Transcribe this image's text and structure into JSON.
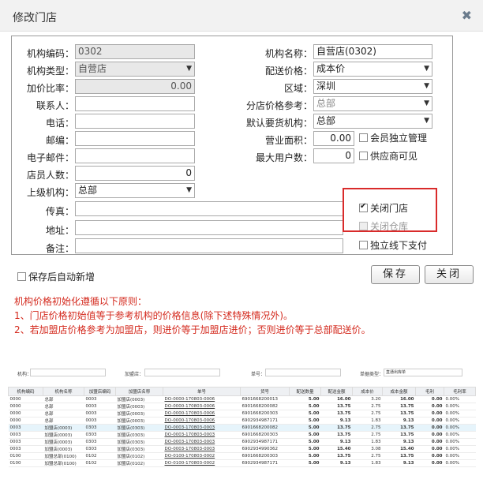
{
  "dialog": {
    "title": "修改门店",
    "close_icon": "✖"
  },
  "form": {
    "org_code": {
      "label": "机构编码：",
      "value": "0302"
    },
    "org_name": {
      "label": "机构名称：",
      "value": "自营店(0302)"
    },
    "org_type": {
      "label": "机构类型：",
      "value": "自营店"
    },
    "dist_price": {
      "label": "配送价格：",
      "value": "成本价"
    },
    "markup": {
      "label": "加价比率：",
      "value": "0.00"
    },
    "region": {
      "label": "区域：",
      "value": "深圳"
    },
    "contact": {
      "label": "联系人：",
      "value": ""
    },
    "branch_price_ref": {
      "label": "分店价格参考：",
      "value": "总部"
    },
    "phone": {
      "label": "电话：",
      "value": ""
    },
    "default_org": {
      "label": "默认要货机构：",
      "value": "总部"
    },
    "zip": {
      "label": "邮编：",
      "value": ""
    },
    "area": {
      "label": "营业面积：",
      "value": "0.00"
    },
    "email": {
      "label": "电子邮件：",
      "value": ""
    },
    "max_users": {
      "label": "最大用户数：",
      "value": "0"
    },
    "staff": {
      "label": "店员人数：",
      "value": "0"
    },
    "parent_org": {
      "label": "上级机构：",
      "value": "总部"
    },
    "fax": {
      "label": "传真：",
      "value": ""
    },
    "address": {
      "label": "地址：",
      "value": ""
    },
    "remark": {
      "label": "备注：",
      "value": ""
    },
    "chk_member": {
      "label": "会员独立管理",
      "checked": false
    },
    "chk_supplier": {
      "label": "供应商可见",
      "checked": false
    },
    "chk_close_store": {
      "label": "关闭门店",
      "checked": true
    },
    "chk_close_wh": {
      "label": "关闭仓库",
      "checked": false
    },
    "chk_offline_pay": {
      "label": "独立线下支付",
      "checked": false
    }
  },
  "footer": {
    "auto_new": "保存后自动新增",
    "save": "保存",
    "close": "关闭"
  },
  "notes": {
    "line1": "机构价格初始化遵循以下原则：",
    "line2": "1、门店价格初始值等于参考机构的价格信息(除下述特殊情况外)。",
    "line3": "2、若加盟店价格参考为加盟店，则进价等于加盟店进价；否则进价等于总部配送价。"
  },
  "screen2": {
    "filters": {
      "org": "机构：",
      "franchise": "加盟店：",
      "order_no": "单号：",
      "type_label": "单据类型：",
      "type_value": "直通出库单"
    },
    "headers": [
      "机构编码",
      "机构名称",
      "加盟店编码",
      "加盟店名称",
      "单号",
      "货号",
      "配送数量",
      "配送金额",
      "成本价",
      "成本金额",
      "毛利",
      "毛利率"
    ],
    "rows": [
      [
        "0000",
        "总部",
        "0003",
        "加盟店(0003)",
        "DO-0000-170803-0006",
        "6901668200013",
        "5.00",
        "16.00",
        "3.20",
        "16.00",
        "0.00",
        "0.00%"
      ],
      [
        "0000",
        "总部",
        "0003",
        "加盟店(0003)",
        "DO-0000-170803-0006",
        "6901668200082",
        "5.00",
        "13.75",
        "2.75",
        "13.75",
        "0.00",
        "0.00%"
      ],
      [
        "0000",
        "总部",
        "0003",
        "加盟店(0003)",
        "DO-0000-170803-0006",
        "6901668200303",
        "5.00",
        "13.75",
        "2.75",
        "13.75",
        "0.00",
        "0.00%"
      ],
      [
        "0000",
        "总部",
        "0003",
        "加盟店(0003)",
        "DO-0000-170803-0006",
        "6902934987171",
        "5.00",
        "9.13",
        "1.83",
        "9.13",
        "0.00",
        "0.00%"
      ],
      [
        "0003",
        "加盟店(0003)",
        "0303",
        "加盟店(0303)",
        "DO-0003-170803-0003",
        "6901668200082",
        "5.00",
        "13.75",
        "2.75",
        "13.75",
        "0.00",
        "0.00%"
      ],
      [
        "0003",
        "加盟店(0003)",
        "0303",
        "加盟店(0303)",
        "DO-0003-170803-0003",
        "6901668200303",
        "5.00",
        "13.75",
        "2.75",
        "13.75",
        "0.00",
        "0.00%"
      ],
      [
        "0003",
        "加盟店(0003)",
        "0303",
        "加盟店(0303)",
        "DO-0003-170803-0003",
        "6902934987171",
        "5.00",
        "9.13",
        "1.83",
        "9.13",
        "0.00",
        "0.00%"
      ],
      [
        "0003",
        "加盟店(0003)",
        "0303",
        "加盟店(0303)",
        "DO-0003-170803-0003",
        "6902934990362",
        "5.00",
        "15.40",
        "3.08",
        "15.40",
        "0.00",
        "0.00%"
      ],
      [
        "0100",
        "加盟总部(0100)",
        "0102",
        "加盟店(0102)",
        "DO-0100-170803-0002",
        "6901668200303",
        "5.00",
        "13.75",
        "2.75",
        "13.75",
        "0.00",
        "0.00%"
      ],
      [
        "0100",
        "加盟总部(0100)",
        "0102",
        "加盟店(0102)",
        "DO-0100-170803-0002",
        "6902934987171",
        "5.00",
        "9.13",
        "1.83",
        "9.13",
        "0.00",
        "0.00%"
      ]
    ]
  }
}
